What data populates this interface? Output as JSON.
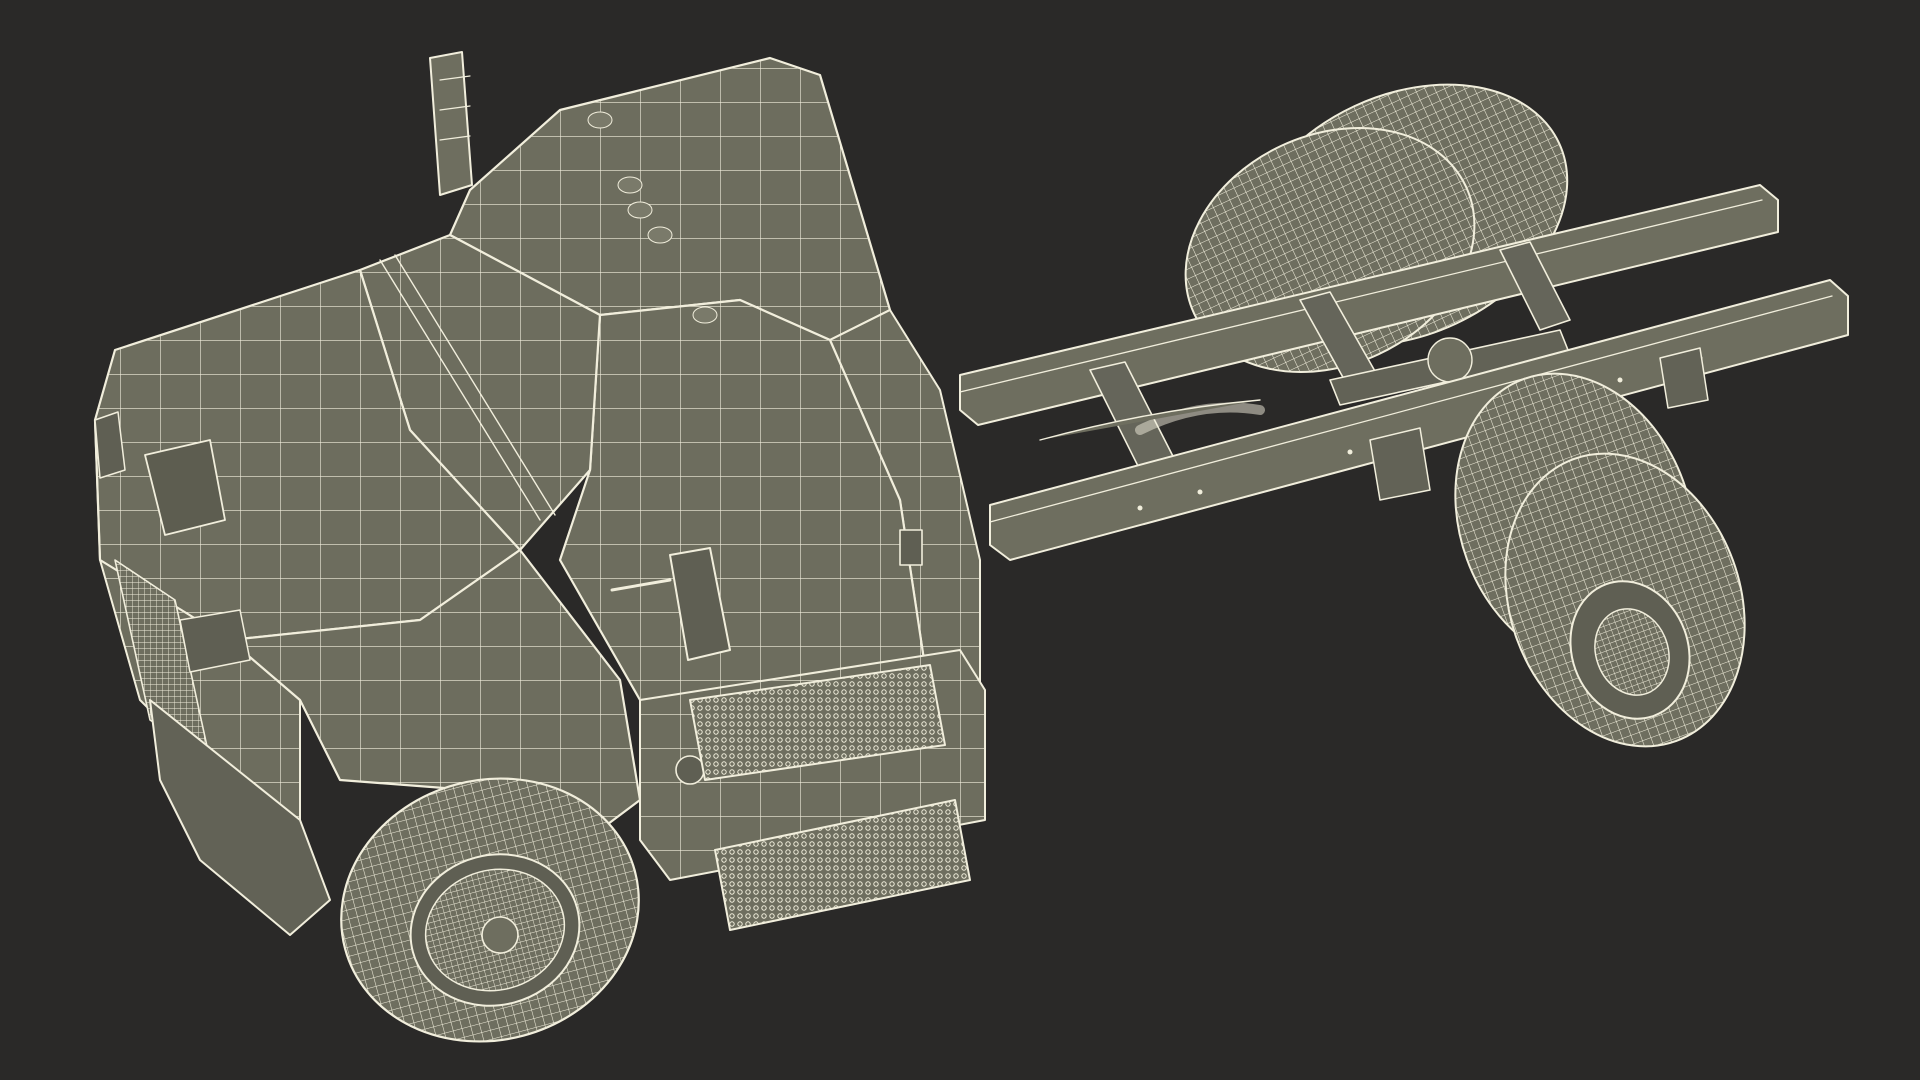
{
  "scene": {
    "background_color": "#2a2928",
    "mesh_fill_color": "#6e6e5f",
    "mesh_fill_dark": "#5d5d50",
    "wire_color": "#f1eedc",
    "subject": "truck-chassis-cab-wireframe"
  }
}
